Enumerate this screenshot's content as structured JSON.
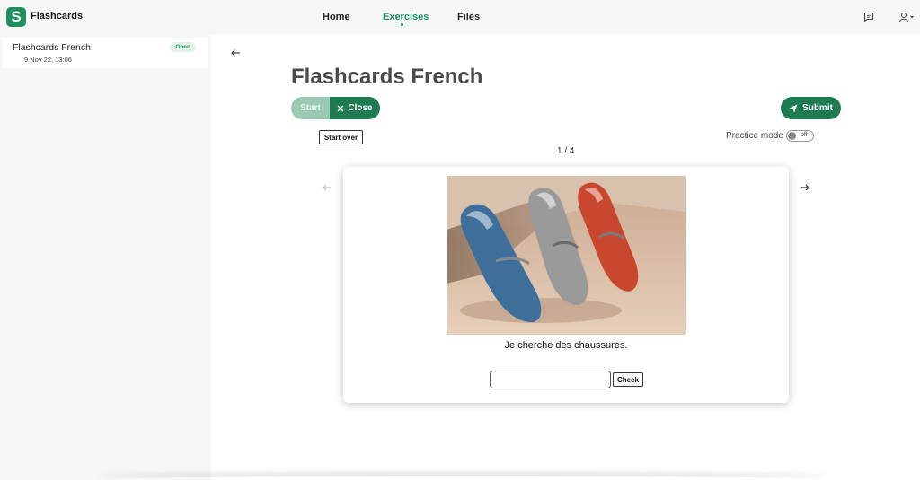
{
  "app": {
    "logo_letter": "S",
    "title": "Flashcards"
  },
  "nav": {
    "items": [
      {
        "label": "Home"
      },
      {
        "label": "Exercises"
      },
      {
        "label": "Files"
      }
    ],
    "active": "Exercises"
  },
  "sidebar": {
    "items": [
      {
        "title": "Flashcards French",
        "date": "9 Nov 22, 13:06",
        "badge": "Open"
      }
    ]
  },
  "exercise": {
    "title": "Flashcards French",
    "start_label": "Start",
    "close_label": "Close",
    "submit_label": "Submit",
    "start_over_label": "Start over",
    "practice_mode_label": "Practice mode",
    "practice_mode_state": "off",
    "counter": "1 / 4",
    "card": {
      "image_alt": "three loafers: blue, grey, red",
      "sentence": "Je cherche des chaussures.",
      "answer_value": "",
      "check_label": "Check"
    }
  },
  "colors": {
    "brand": "#1e8f5f",
    "button_dark": "#1e7a50",
    "button_disabled": "#9cc9b4",
    "badge_bg": "#e3f3ea"
  },
  "icons": [
    "comment-icon",
    "user-icon",
    "arrow-left-icon",
    "arrow-right-icon",
    "send-icon",
    "close-icon"
  ]
}
